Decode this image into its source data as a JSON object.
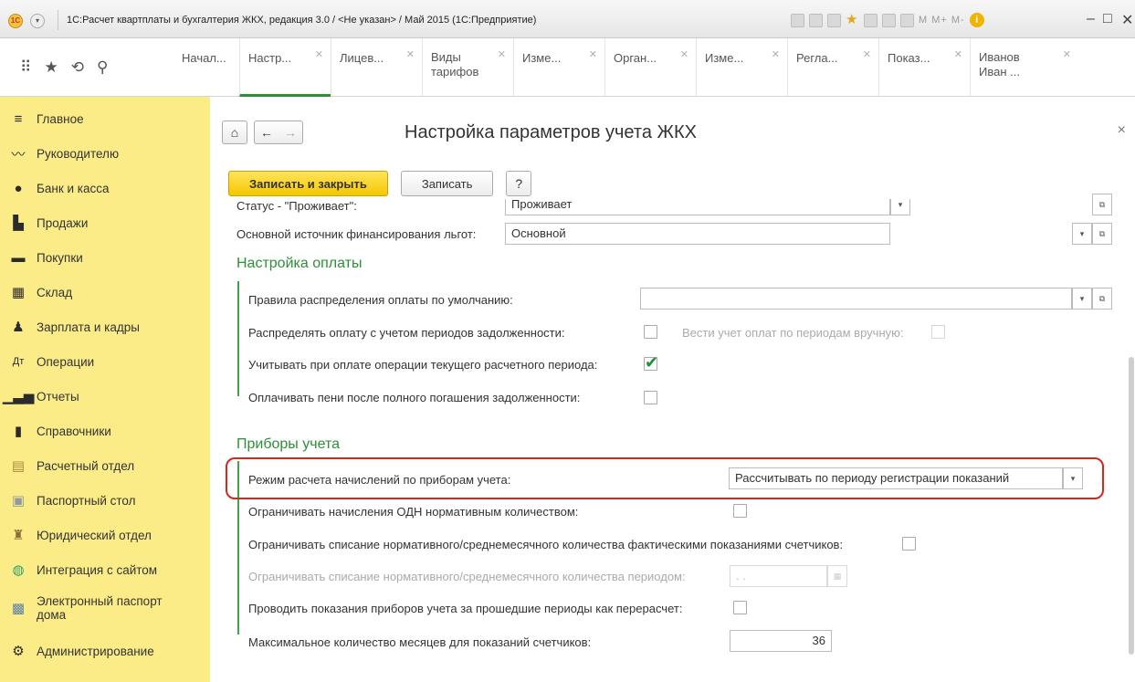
{
  "window": {
    "title": "1С:Расчет квартплаты и бухгалтерия ЖКХ, редакция 3.0 / <Не указан> / Май 2015  (1С:Предприятие)",
    "logo_text": "1С",
    "toolbar_m_text": "M  M+  M-"
  },
  "tabs": [
    {
      "label": "Начал..."
    },
    {
      "label": "Настр..."
    },
    {
      "label": "Лицев..."
    },
    {
      "label": "Виды тарифов",
      "line1": "Виды",
      "line2": "тарифов"
    },
    {
      "label": "Изме..."
    },
    {
      "label": "Орган..."
    },
    {
      "label": "Изме..."
    },
    {
      "label": "Регла..."
    },
    {
      "label": "Показ..."
    },
    {
      "label": "Иванов Иван ...",
      "line1": "Иванов",
      "line2": "Иван ..."
    }
  ],
  "sidebar": {
    "items": [
      {
        "label": "Главное",
        "icon": "menu-icon"
      },
      {
        "label": "Руководителю",
        "icon": "chart-line-icon"
      },
      {
        "label": "Банк и касса",
        "icon": "bank-icon"
      },
      {
        "label": "Продажи",
        "icon": "bag-icon"
      },
      {
        "label": "Покупки",
        "icon": "cart-icon"
      },
      {
        "label": "Склад",
        "icon": "warehouse-icon"
      },
      {
        "label": "Зарплата и кадры",
        "icon": "person-icon"
      },
      {
        "label": "Операции",
        "icon": "operations-icon"
      },
      {
        "label": "Отчеты",
        "icon": "bar-chart-icon"
      },
      {
        "label": "Справочники",
        "icon": "book-icon"
      },
      {
        "label": "Расчетный отдел",
        "icon": "calc-dept-icon"
      },
      {
        "label": "Паспортный стол",
        "icon": "passport-icon"
      },
      {
        "label": "Юридический отдел",
        "icon": "legal-icon"
      },
      {
        "label": "Интеграция с сайтом",
        "icon": "globe-icon"
      },
      {
        "label": "Электронный паспорт дома",
        "line1": "Электронный паспорт",
        "line2": "дома",
        "icon": "house-passport-icon"
      },
      {
        "label": "Администрирование",
        "icon": "gear-icon"
      }
    ]
  },
  "form": {
    "title": "Настройка параметров учета ЖКХ",
    "save_close_label": "Записать и закрыть",
    "save_label": "Записать",
    "help_label": "?",
    "close_symbol": "×",
    "status_label": "Статус - \"Проживает\":",
    "status_value": "Проживает",
    "funding_label": "Основной источник финансирования льгот:",
    "funding_value": "Основной",
    "section_payment": "Настройка оплаты",
    "dist_rules_label": "Правила распределения оплаты по умолчанию:",
    "dist_rules_value": "",
    "dist_debt_label": "Распределять оплату с учетом периодов задолженности:",
    "dist_debt_checked": false,
    "manual_periods_label": "Вести учет оплат по периодам вручную:",
    "manual_periods_checked": false,
    "current_period_label": "Учитывать при оплате операции текущего расчетного периода:",
    "current_period_checked": true,
    "penalty_label": "Оплачивать пени после полного погашения задолженности:",
    "penalty_checked": false,
    "section_meters": "Приборы учета",
    "calc_mode_label": "Режим расчета начислений по приборам учета:",
    "calc_mode_value": "Рассчитывать по периоду регистрации показаний",
    "limit_odn_label": "Ограничивать начисления ОДН нормативным количеством:",
    "limit_odn_checked": false,
    "limit_writeoff_label": "Ограничивать списание нормативного/среднемесячного количества фактическими показаниями счетчиков:",
    "limit_writeoff_checked": false,
    "limit_period_label": "Ограничивать списание нормативного/среднемесячного количества периодом:",
    "limit_period_value": "  .  .",
    "past_readings_label": "Проводить показания приборов учета за прошедшие периоды как перерасчет:",
    "past_readings_checked": false,
    "max_months_label": "Максимальное количество месяцев для показаний счетчиков:",
    "max_months_value": "36"
  }
}
